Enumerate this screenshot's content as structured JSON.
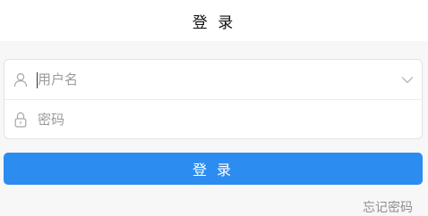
{
  "header": {
    "title": "登 录"
  },
  "form": {
    "username": {
      "placeholder": "用户名",
      "value": "",
      "icon": "user-icon",
      "dropdown_icon": "chevron-down-icon"
    },
    "password": {
      "placeholder": "密码",
      "value": "",
      "icon": "lock-icon"
    }
  },
  "actions": {
    "login_label": "登 录",
    "forgot_label": "忘记密码"
  },
  "colors": {
    "primary": "#2d8cf0",
    "background": "#f7f7f7",
    "placeholder": "#9a9a9a",
    "link": "#8d8d8d"
  }
}
